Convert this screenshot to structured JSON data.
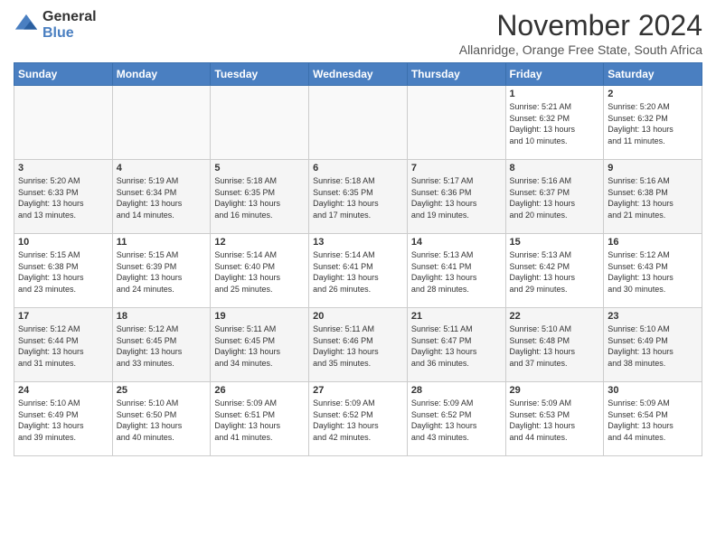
{
  "logo": {
    "general": "General",
    "blue": "Blue"
  },
  "title": "November 2024",
  "location": "Allanridge, Orange Free State, South Africa",
  "days_of_week": [
    "Sunday",
    "Monday",
    "Tuesday",
    "Wednesday",
    "Thursday",
    "Friday",
    "Saturday"
  ],
  "weeks": [
    [
      {
        "day": "",
        "info": ""
      },
      {
        "day": "",
        "info": ""
      },
      {
        "day": "",
        "info": ""
      },
      {
        "day": "",
        "info": ""
      },
      {
        "day": "",
        "info": ""
      },
      {
        "day": "1",
        "info": "Sunrise: 5:21 AM\nSunset: 6:32 PM\nDaylight: 13 hours\nand 10 minutes."
      },
      {
        "day": "2",
        "info": "Sunrise: 5:20 AM\nSunset: 6:32 PM\nDaylight: 13 hours\nand 11 minutes."
      }
    ],
    [
      {
        "day": "3",
        "info": "Sunrise: 5:20 AM\nSunset: 6:33 PM\nDaylight: 13 hours\nand 13 minutes."
      },
      {
        "day": "4",
        "info": "Sunrise: 5:19 AM\nSunset: 6:34 PM\nDaylight: 13 hours\nand 14 minutes."
      },
      {
        "day": "5",
        "info": "Sunrise: 5:18 AM\nSunset: 6:35 PM\nDaylight: 13 hours\nand 16 minutes."
      },
      {
        "day": "6",
        "info": "Sunrise: 5:18 AM\nSunset: 6:35 PM\nDaylight: 13 hours\nand 17 minutes."
      },
      {
        "day": "7",
        "info": "Sunrise: 5:17 AM\nSunset: 6:36 PM\nDaylight: 13 hours\nand 19 minutes."
      },
      {
        "day": "8",
        "info": "Sunrise: 5:16 AM\nSunset: 6:37 PM\nDaylight: 13 hours\nand 20 minutes."
      },
      {
        "day": "9",
        "info": "Sunrise: 5:16 AM\nSunset: 6:38 PM\nDaylight: 13 hours\nand 21 minutes."
      }
    ],
    [
      {
        "day": "10",
        "info": "Sunrise: 5:15 AM\nSunset: 6:38 PM\nDaylight: 13 hours\nand 23 minutes."
      },
      {
        "day": "11",
        "info": "Sunrise: 5:15 AM\nSunset: 6:39 PM\nDaylight: 13 hours\nand 24 minutes."
      },
      {
        "day": "12",
        "info": "Sunrise: 5:14 AM\nSunset: 6:40 PM\nDaylight: 13 hours\nand 25 minutes."
      },
      {
        "day": "13",
        "info": "Sunrise: 5:14 AM\nSunset: 6:41 PM\nDaylight: 13 hours\nand 26 minutes."
      },
      {
        "day": "14",
        "info": "Sunrise: 5:13 AM\nSunset: 6:41 PM\nDaylight: 13 hours\nand 28 minutes."
      },
      {
        "day": "15",
        "info": "Sunrise: 5:13 AM\nSunset: 6:42 PM\nDaylight: 13 hours\nand 29 minutes."
      },
      {
        "day": "16",
        "info": "Sunrise: 5:12 AM\nSunset: 6:43 PM\nDaylight: 13 hours\nand 30 minutes."
      }
    ],
    [
      {
        "day": "17",
        "info": "Sunrise: 5:12 AM\nSunset: 6:44 PM\nDaylight: 13 hours\nand 31 minutes."
      },
      {
        "day": "18",
        "info": "Sunrise: 5:12 AM\nSunset: 6:45 PM\nDaylight: 13 hours\nand 33 minutes."
      },
      {
        "day": "19",
        "info": "Sunrise: 5:11 AM\nSunset: 6:45 PM\nDaylight: 13 hours\nand 34 minutes."
      },
      {
        "day": "20",
        "info": "Sunrise: 5:11 AM\nSunset: 6:46 PM\nDaylight: 13 hours\nand 35 minutes."
      },
      {
        "day": "21",
        "info": "Sunrise: 5:11 AM\nSunset: 6:47 PM\nDaylight: 13 hours\nand 36 minutes."
      },
      {
        "day": "22",
        "info": "Sunrise: 5:10 AM\nSunset: 6:48 PM\nDaylight: 13 hours\nand 37 minutes."
      },
      {
        "day": "23",
        "info": "Sunrise: 5:10 AM\nSunset: 6:49 PM\nDaylight: 13 hours\nand 38 minutes."
      }
    ],
    [
      {
        "day": "24",
        "info": "Sunrise: 5:10 AM\nSunset: 6:49 PM\nDaylight: 13 hours\nand 39 minutes."
      },
      {
        "day": "25",
        "info": "Sunrise: 5:10 AM\nSunset: 6:50 PM\nDaylight: 13 hours\nand 40 minutes."
      },
      {
        "day": "26",
        "info": "Sunrise: 5:09 AM\nSunset: 6:51 PM\nDaylight: 13 hours\nand 41 minutes."
      },
      {
        "day": "27",
        "info": "Sunrise: 5:09 AM\nSunset: 6:52 PM\nDaylight: 13 hours\nand 42 minutes."
      },
      {
        "day": "28",
        "info": "Sunrise: 5:09 AM\nSunset: 6:52 PM\nDaylight: 13 hours\nand 43 minutes."
      },
      {
        "day": "29",
        "info": "Sunrise: 5:09 AM\nSunset: 6:53 PM\nDaylight: 13 hours\nand 44 minutes."
      },
      {
        "day": "30",
        "info": "Sunrise: 5:09 AM\nSunset: 6:54 PM\nDaylight: 13 hours\nand 44 minutes."
      }
    ]
  ]
}
